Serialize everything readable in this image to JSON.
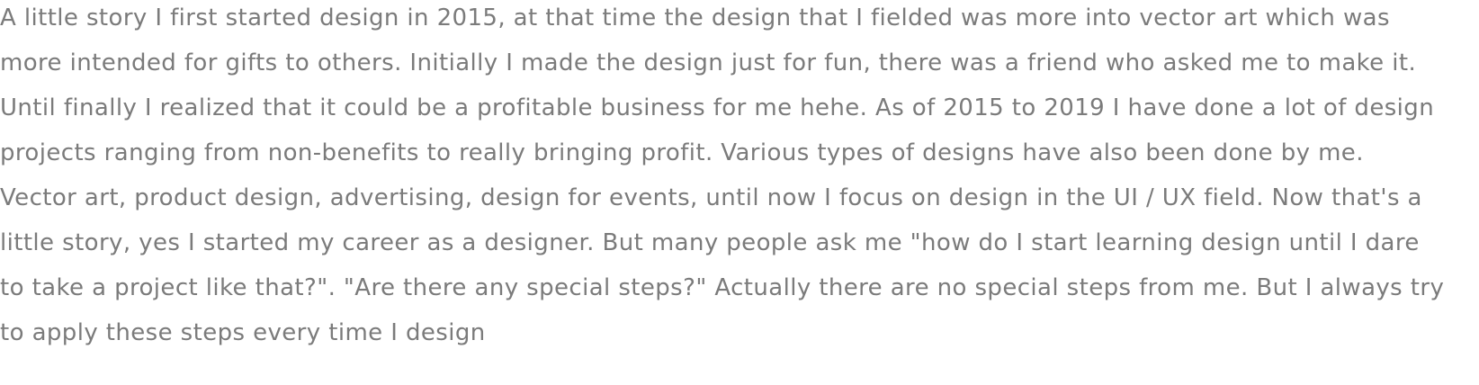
{
  "story": {
    "lines": [
      "A little story I first started design in 2015, at that time the design that I fielded was more into vector art which was",
      "more intended for gifts to others. Initially I made the design just for fun, there was a friend who asked me to make it.",
      "Until finally I realized that it could be a profitable business for me hehe. As of 2015 to 2019 I have done a lot of design",
      "projects ranging from non-benefits to really bringing profit. Various types of designs have also been done by me.",
      "Vector art, product design, advertising, design for events, until now I focus on design in the UI / UX field. Now that's a",
      "little story, yes I started my career as a designer. But many people ask me \"how do I start learning design until I dare",
      "to take a project like that?\". \"Are there any special steps?\" Actually there are no special steps from me. But I always try",
      "to apply these steps every time I design"
    ]
  }
}
